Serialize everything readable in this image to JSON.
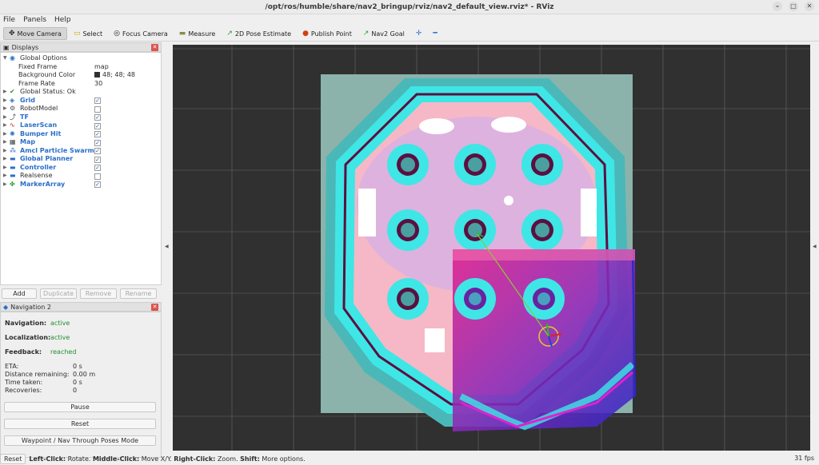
{
  "window": {
    "title": "/opt/ros/humble/share/nav2_bringup/rviz/nav2_default_view.rviz* - RViz"
  },
  "menu": [
    "File",
    "Panels",
    "Help"
  ],
  "toolbar": [
    {
      "label": "Move Camera",
      "icon": "move-camera-icon",
      "glyph": "✥",
      "active": true
    },
    {
      "label": "Select",
      "icon": "select-icon",
      "glyph": "▭",
      "active": false
    },
    {
      "label": "Focus Camera",
      "icon": "focus-camera-icon",
      "glyph": "◎",
      "active": false
    },
    {
      "label": "Measure",
      "icon": "measure-icon",
      "glyph": "▬",
      "active": false
    },
    {
      "label": "2D Pose Estimate",
      "icon": "pose-estimate-icon",
      "glyph": "↗",
      "active": false
    },
    {
      "label": "Publish Point",
      "icon": "publish-point-icon",
      "glyph": "📍",
      "active": false
    },
    {
      "label": "Nav2 Goal",
      "icon": "nav2-goal-icon",
      "glyph": "↗",
      "active": false
    },
    {
      "label": "",
      "icon": "add-tool-icon",
      "glyph": "✛",
      "active": false
    },
    {
      "label": "",
      "icon": "remove-tool-icon",
      "glyph": "━",
      "active": false
    }
  ],
  "displays": {
    "title": "Displays",
    "global_options": "Global Options",
    "fixed_frame_label": "Fixed Frame",
    "fixed_frame_value": "map",
    "background_label": "Background Color",
    "background_value": "48; 48; 48",
    "frame_rate_label": "Frame Rate",
    "frame_rate_value": "30",
    "global_status": "Global Status: Ok",
    "items": [
      {
        "label": "Grid",
        "checked": true,
        "blue": true,
        "icon": "grid-icon",
        "glyph": "◈"
      },
      {
        "label": "RobotModel",
        "checked": false,
        "blue": false,
        "icon": "robot-model-icon",
        "glyph": "⚙"
      },
      {
        "label": "TF",
        "checked": true,
        "blue": true,
        "icon": "tf-icon",
        "glyph": "⤴"
      },
      {
        "label": "LaserScan",
        "checked": true,
        "blue": true,
        "icon": "laser-scan-icon",
        "glyph": "∿"
      },
      {
        "label": "Bumper Hit",
        "checked": true,
        "blue": true,
        "icon": "bumper-hit-icon",
        "glyph": "✺"
      },
      {
        "label": "Map",
        "checked": true,
        "blue": true,
        "icon": "map-icon",
        "glyph": "▦"
      },
      {
        "label": "Amcl Particle Swarm",
        "checked": true,
        "blue": true,
        "icon": "particle-swarm-icon",
        "glyph": "⁂"
      },
      {
        "label": "Global Planner",
        "checked": true,
        "blue": true,
        "icon": "folder-icon",
        "glyph": "▬"
      },
      {
        "label": "Controller",
        "checked": true,
        "blue": true,
        "icon": "folder-icon",
        "glyph": "▬"
      },
      {
        "label": "Realsense",
        "checked": false,
        "blue": false,
        "icon": "folder-icon",
        "glyph": "▬"
      },
      {
        "label": "MarkerArray",
        "checked": true,
        "blue": true,
        "icon": "marker-array-icon",
        "glyph": "✤"
      }
    ],
    "buttons": [
      "Add",
      "Duplicate",
      "Remove",
      "Rename"
    ]
  },
  "navigation": {
    "title": "Navigation 2",
    "navigation_label": "Navigation:",
    "navigation_value": "active",
    "localization_label": "Localization:",
    "localization_value": "active",
    "feedback_label": "Feedback:",
    "feedback_value": "reached",
    "eta_label": "ETA:",
    "eta_value": "0 s",
    "distance_label": "Distance remaining:",
    "distance_value": "0.00 m",
    "time_label": "Time taken:",
    "time_value": "0 s",
    "recoveries_label": "Recoveries:",
    "recoveries_value": "0",
    "pause": "Pause",
    "reset": "Reset",
    "waypoint": "Waypoint / Nav Through Poses Mode"
  },
  "status": {
    "reset": "Reset",
    "left_click": "Left-Click:",
    "left_desc": "Rotate.",
    "middle_click": "Middle-Click:",
    "middle_desc": "Move X/Y.",
    "right_click": "Right-Click:",
    "right_desc": "Zoom.",
    "shift": "Shift:",
    "shift_desc": "More options.",
    "fps": "31 fps"
  },
  "colors": {
    "viewport_bg": "#303030",
    "costmap_cyan": "#3fe6e6",
    "costmap_pink": "#f6b8c6",
    "path_magenta": "#e020d0"
  }
}
